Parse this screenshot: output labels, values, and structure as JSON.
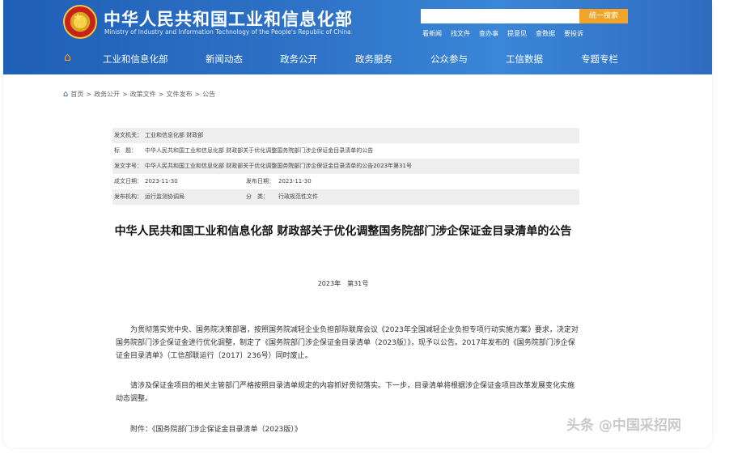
{
  "header": {
    "title": "中华人民共和国工业和信息化部",
    "subtitle": "Ministry of Industry and Information Technology of the People's Republic of China",
    "search_placeholder": "",
    "search_button": "统一搜索",
    "quick_links": [
      "看新闻",
      "找文件",
      "查办事",
      "提意见",
      "查数据",
      "要投诉"
    ]
  },
  "nav": {
    "items": [
      "工业和信息化部",
      "新闻动态",
      "政务公开",
      "政务服务",
      "公众参与",
      "工信数据",
      "专题专栏"
    ]
  },
  "breadcrumb": [
    "首页",
    "政务公开",
    "政策文件",
    "文件发布",
    "公告"
  ],
  "meta": {
    "issuer_label": "发文机关：",
    "issuer": "工业和信息化部 财政部",
    "title_label": "标　题：",
    "title": "中华人民共和国工业和信息化部 财政部关于优化调整国务院部门涉企保证金目录清单的公告",
    "number_label": "发文字号：",
    "number": "中华人民共和国工业和信息化部 财政部关于优化调整国务院部门涉企保证金目录清单的公告2023年第31号",
    "created_label": "成文日期：",
    "created": "2023-11-30",
    "published_label": "发布日期：",
    "published": "2023-11-30",
    "agency_label": "发布机构：",
    "agency": "运行监测协调局",
    "category_label": "分　类：",
    "category": "行政规范性文件"
  },
  "document": {
    "title": "中华人民共和国工业和信息化部 财政部关于优化调整国务院部门涉企保证金目录清单的公告",
    "number": "2023年　第31号",
    "paragraph1": "为贯彻落实党中央、国务院决策部署，按照国务院减轻企业负担部际联席会议《2023年全国减轻企业负担专项行动实施方案》要求，决定对国务院部门涉企保证金进行优化调整，制定了《国务院部门涉企保证金目录清单（2023版）》，现予以公告。2017年发布的《国务院部门涉企保证金目录清单》（工信部联运行〔2017〕236号）同时废止。",
    "paragraph2": "请涉及保证金项目的相关主管部门严格按照目录清单规定的内容抓好贯彻落实。下一步，目录清单将根据涉企保证金项目改革发展变化实施动态调整。",
    "attachment": "附件：《国务院部门涉企保证金目录清单（2023版）》"
  },
  "watermark": "头条 @中国采招网"
}
